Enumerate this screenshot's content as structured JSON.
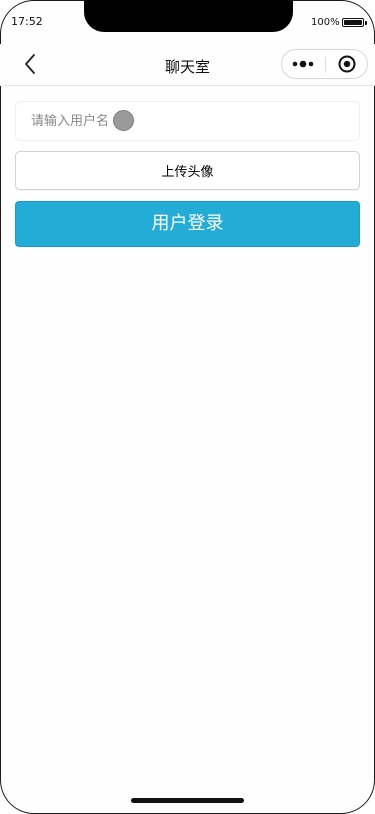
{
  "status_bar": {
    "time": "17:52",
    "battery_text": "100%",
    "battery_level": 1.0
  },
  "navbar": {
    "title": "聊天室",
    "back_icon": "chevron-left-icon",
    "more_icon": "more-dots-icon",
    "close_icon": "target-close-icon"
  },
  "form": {
    "username_placeholder": "请输入用户名",
    "username_value": "",
    "upload_label": "上传头像",
    "login_label": "用户登录"
  },
  "colors": {
    "login_button": "#23add6",
    "avatar_placeholder": "#9a9a9a"
  }
}
